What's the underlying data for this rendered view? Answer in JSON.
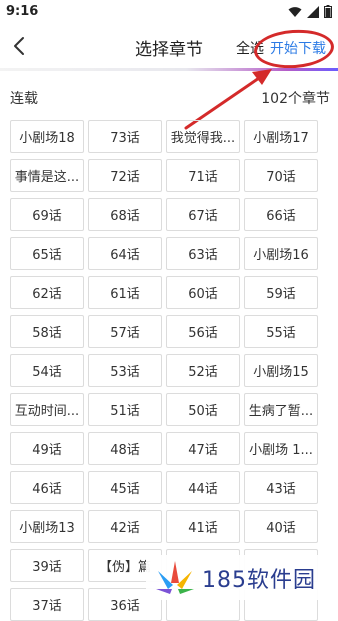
{
  "status_bar": {
    "time": "9:16"
  },
  "nav": {
    "title": "选择章节",
    "select_all": "全选",
    "start_download": "开始下载"
  },
  "section": {
    "name": "连载",
    "count": "102个章节"
  },
  "chapters": [
    "小剧场18",
    "73话",
    "我觉得我...",
    "小剧场17",
    "事情是这...",
    "72话",
    "71话",
    "70话",
    "69话",
    "68话",
    "67话",
    "66话",
    "65话",
    "64话",
    "63话",
    "小剧场16",
    "62话",
    "61话",
    "60话",
    "59话",
    "58话",
    "57话",
    "56话",
    "55话",
    "54话",
    "53话",
    "52话",
    "小剧场15",
    "互动时间...",
    "51话",
    "50话",
    "生病了暂...",
    "49话",
    "48话",
    "47话",
    "小剧场 1...",
    "46话",
    "45话",
    "44话",
    "43话",
    "小剧场13",
    "42话",
    "41话",
    "40话",
    "39话",
    "【伪】篇",
    "",
    "",
    "37话",
    "36话",
    "",
    ""
  ],
  "watermark": {
    "text": "185软件园"
  },
  "colors": {
    "accent_blue": "#2c7be5",
    "annotation_red": "#d42a2a"
  }
}
